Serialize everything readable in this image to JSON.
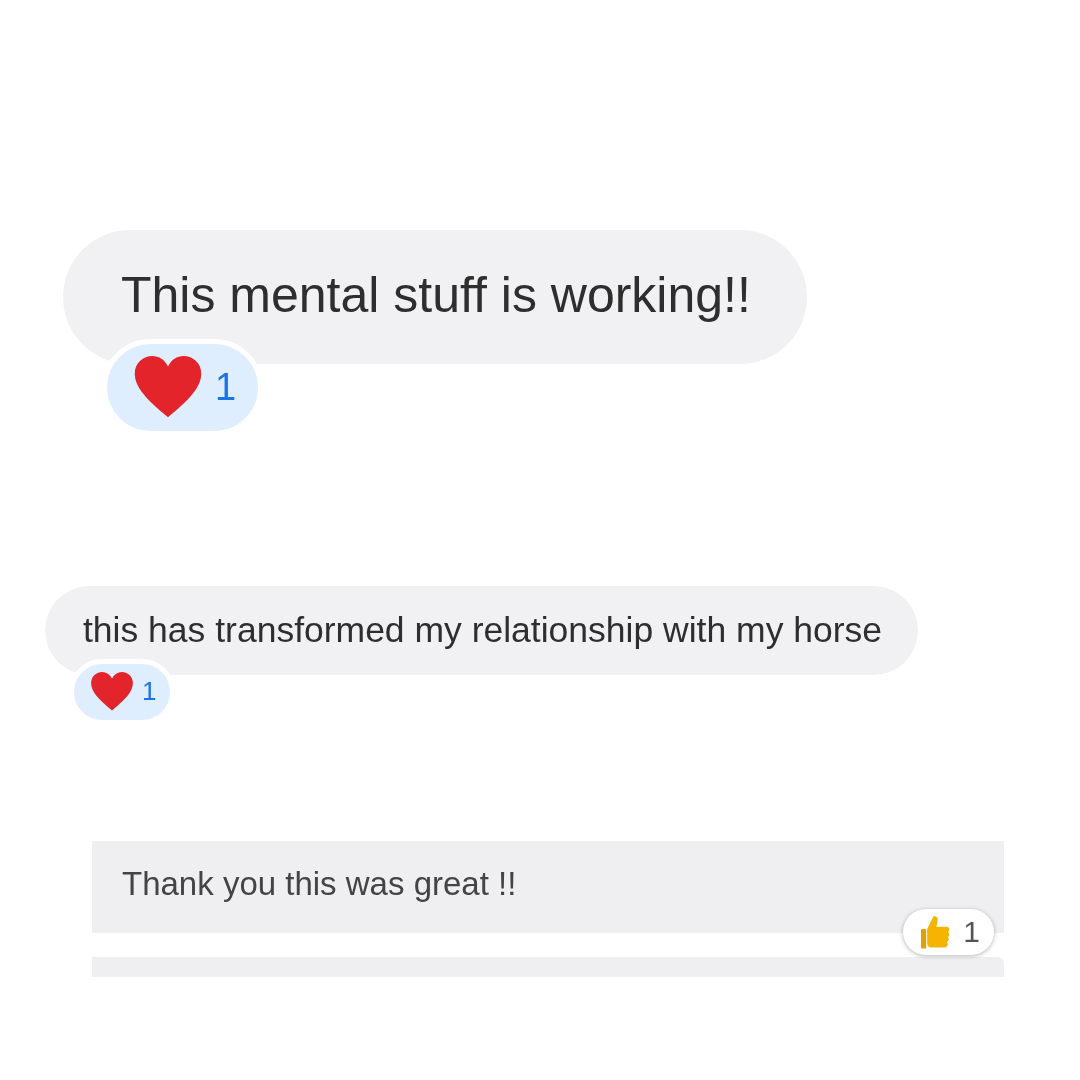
{
  "messages": [
    {
      "kind": "large",
      "text": "This mental stuff is working!!",
      "reaction": {
        "kind": "heart",
        "count": "1"
      }
    },
    {
      "kind": "small",
      "text": "this has transformed my relationship with my horse",
      "reaction": {
        "kind": "heart",
        "count": "1"
      }
    },
    {
      "kind": "card",
      "text": "Thank you this was great !!",
      "reaction": {
        "kind": "thumbs-up",
        "count": "1"
      }
    },
    {
      "kind": "card-edge"
    }
  ]
}
